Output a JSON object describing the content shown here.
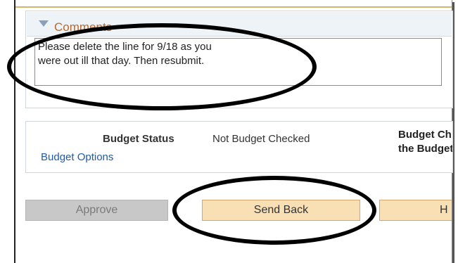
{
  "comments": {
    "title": "Comments",
    "text": "Please delete the line for 9/18 as you\nwere out ill that day. Then resubmit."
  },
  "budget": {
    "status_label": "Budget Status",
    "status_value": "Not Budget Checked",
    "options_link": "Budget Options",
    "check_line1": "Budget Ch",
    "check_line2": "the Budget"
  },
  "actions": {
    "approve_label": "Approve",
    "send_back_label": "Send Back",
    "hold_label": "H"
  },
  "annotations": {
    "stroke_color": "#000000"
  },
  "colors": {
    "comments_title": "#b86a2d",
    "link": "#1f5ba7",
    "button_active_bg": "#f9dfb4",
    "button_disabled_bg": "#c8c8c8"
  }
}
